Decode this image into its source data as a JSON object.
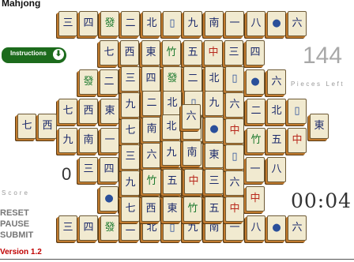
{
  "app": {
    "title": "Mahjong"
  },
  "instructions": {
    "label": "Instructions",
    "icon": "download-arrow-icon"
  },
  "pieces": {
    "count": "144",
    "label": "Pieces Left"
  },
  "score": {
    "value": "0",
    "label": "Score"
  },
  "controls": {
    "reset": "RESET",
    "pause": "PAUSE",
    "submit": "SUBMIT"
  },
  "timer": {
    "value": "00:04"
  },
  "version": {
    "label": "Version 1.2"
  },
  "colors": {
    "accent_green": "#1c6b1c",
    "version_red": "#c00000",
    "tile_face": "#f1ead0",
    "tile_edge": "#c07a2e"
  },
  "tile_faces": [
    "三",
    "西",
    "一",
    "二",
    "五",
    "六",
    "九",
    "四",
    "東",
    "八",
    "北",
    "中",
    "七",
    "南",
    "發",
    "竹",
    "●",
    "▯"
  ]
}
